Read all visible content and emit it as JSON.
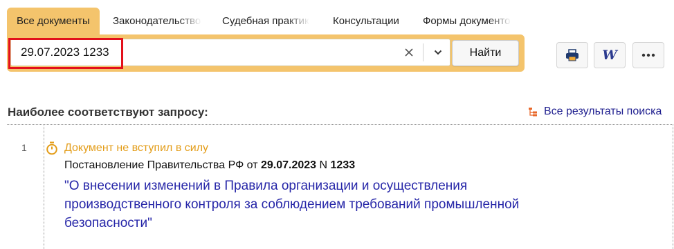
{
  "tabs": [
    {
      "label": "Все документы",
      "active": true
    },
    {
      "label": "Законодательство"
    },
    {
      "label": "Судебная практика"
    },
    {
      "label": "Консультации"
    },
    {
      "label": "Формы документов"
    }
  ],
  "search": {
    "value": "29.07.2023 1233",
    "clear_icon": "close-icon",
    "dropdown_icon": "chevron-down-icon",
    "find_label": "Найти"
  },
  "toolbar": {
    "print_icon": "printer-icon",
    "word_icon": "word-export-icon",
    "word_glyph": "W",
    "more_icon": "more-dots-icon"
  },
  "results": {
    "heading": "Наиболее соответствуют запросу:",
    "all_results_label": "Все результаты поиска",
    "items": [
      {
        "number": "1",
        "status": "Документ не вступил в силу",
        "desc_prefix": "Постановление Правительства РФ от ",
        "desc_date": "29.07.2023",
        "desc_mid": " N ",
        "desc_num": "1233",
        "title_line1": "\"О внесении изменений в Правила организации и осуществления",
        "title_line2": "производственного контроля за соблюдением требований промышленной",
        "title_line3": "безопасности\""
      }
    ]
  },
  "colors": {
    "tab_accent": "#f4c46c",
    "highlight": "#e3101b",
    "status": "#e39c17",
    "link": "#2626a8"
  }
}
